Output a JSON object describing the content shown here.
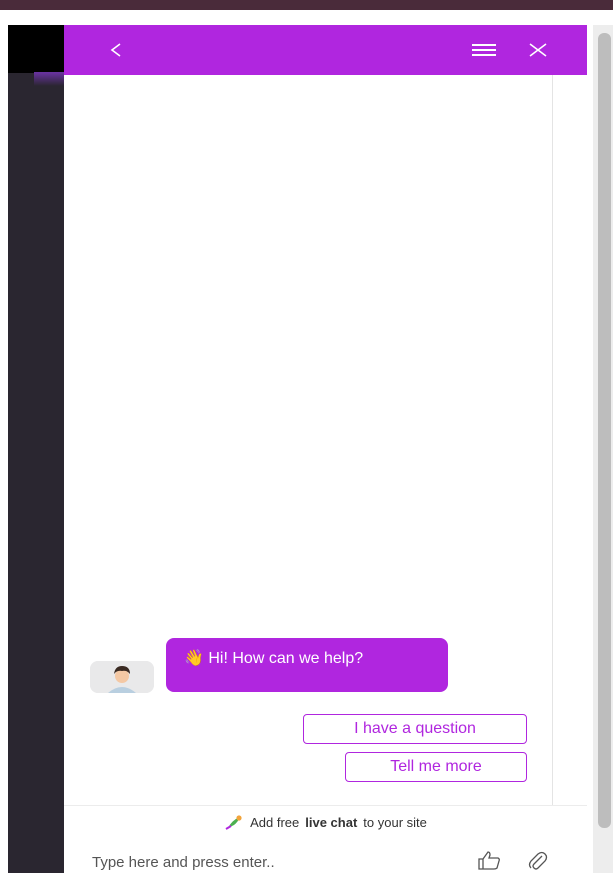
{
  "chat": {
    "header": {
      "back_icon": "chevron-left",
      "menu_icon": "hamburger-menu",
      "close_icon": "close-x"
    },
    "messages": [
      {
        "from": "agent",
        "emoji": "👋",
        "text": "Hi! How can we help?"
      }
    ],
    "quick_replies": [
      "I have a question",
      "Tell me more"
    ],
    "footer": {
      "branding_prefix": "Add free",
      "branding_bold": "live chat",
      "branding_suffix": "to your site",
      "input_placeholder": "Type here and press enter..",
      "like_icon": "thumbs-up",
      "attach_icon": "paperclip"
    }
  },
  "colors": {
    "accent": "#b026df",
    "sidebar": "#2a2630",
    "topbar": "#4a2b3a"
  }
}
